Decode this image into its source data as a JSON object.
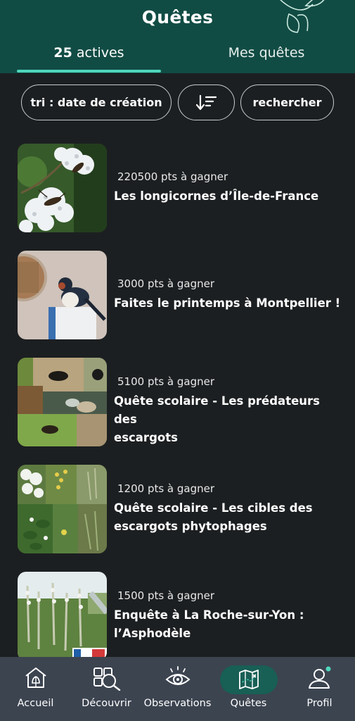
{
  "header": {
    "title": "Quêtes",
    "tabs": [
      {
        "count": "25",
        "label": " actives"
      },
      {
        "label": "Mes quêtes"
      }
    ]
  },
  "filters": {
    "sort_label": "tri : date de création",
    "order_icon": "sort-descending-icon",
    "search_label": "rechercher"
  },
  "quests": [
    {
      "points": "220500 pts à gagner",
      "title_lines": [
        "Les longicornes d’Île-de-France"
      ],
      "image": "longhorn-beetle-on-flowers"
    },
    {
      "points": "3000 pts à gagner",
      "title_lines": [
        "Faites le printemps à Montpellier !"
      ],
      "image": "swallow-photo"
    },
    {
      "points": "5100 pts à gagner",
      "title_lines": [
        "Quête scolaire - Les prédateurs des",
        "escargots"
      ],
      "image": "predators-collage"
    },
    {
      "points": "1200 pts à gagner",
      "title_lines": [
        "Quête scolaire - Les cibles des",
        "escargots phytophages"
      ],
      "image": "plants-collage"
    },
    {
      "points": "1500 pts à gagner",
      "title_lines": [
        "Enquête à La Roche-sur-Yon :",
        "l’Asphodèle"
      ],
      "image": "asphodel-field"
    }
  ],
  "bottom_nav": [
    {
      "label": "Accueil",
      "icon": "home-icon"
    },
    {
      "label": "Découvrir",
      "icon": "discover-icon"
    },
    {
      "label": "Observations",
      "icon": "eye-icon"
    },
    {
      "label": "Quêtes",
      "icon": "map-icon",
      "active": true
    },
    {
      "label": "Profil",
      "icon": "profile-icon"
    }
  ],
  "colors": {
    "header_bg": "#114c44",
    "accent": "#4fd6bc",
    "background": "#1c1f21",
    "nav_bg": "#3c4450",
    "active_pill": "#185f55",
    "notification_dot": "#4fd6bc"
  }
}
